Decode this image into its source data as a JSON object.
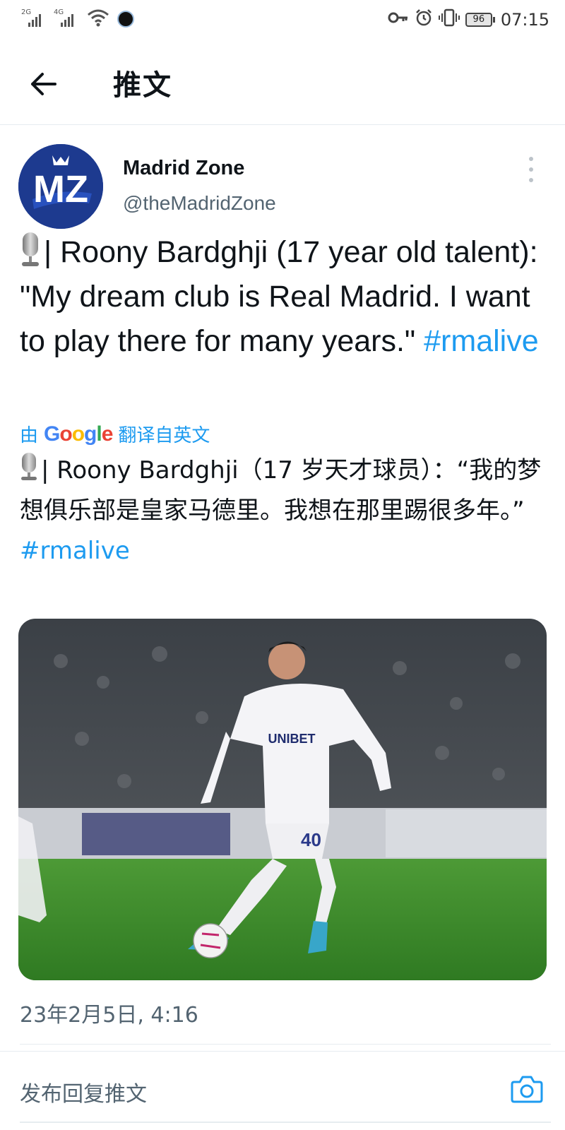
{
  "status_bar": {
    "net1": "2G",
    "net2": "4G",
    "battery": "96",
    "time": "07:15"
  },
  "header": {
    "title": "推文"
  },
  "tweet": {
    "avatar_text": "MZ",
    "author_name": "Madrid Zone",
    "author_handle": "@theMadridZone",
    "text_main": "| Roony Bardghji (17 year old talent): \"My dream club is Real Madrid. I want to play there for many years.\"",
    "hashtag": "#rmalive",
    "translate_prefix": "由",
    "translate_brand": "Google",
    "translate_suffix": "翻译自英文",
    "translated_main": "| Roony Bardghji（17 岁天才球员）：“我的梦想俱乐部是皇家马德里。我想在那里踢很多年。”",
    "translated_hashtag": "#rmalive",
    "media_text": "UNIBET",
    "jersey_number": "40",
    "timestamp": "23年2月5日, 4:16"
  },
  "reply": {
    "placeholder": "发布回复推文"
  },
  "colors": {
    "link": "#1d9bf0",
    "avatar_bg": "#1d3a8f",
    "pitch": "#3f8b2e"
  }
}
